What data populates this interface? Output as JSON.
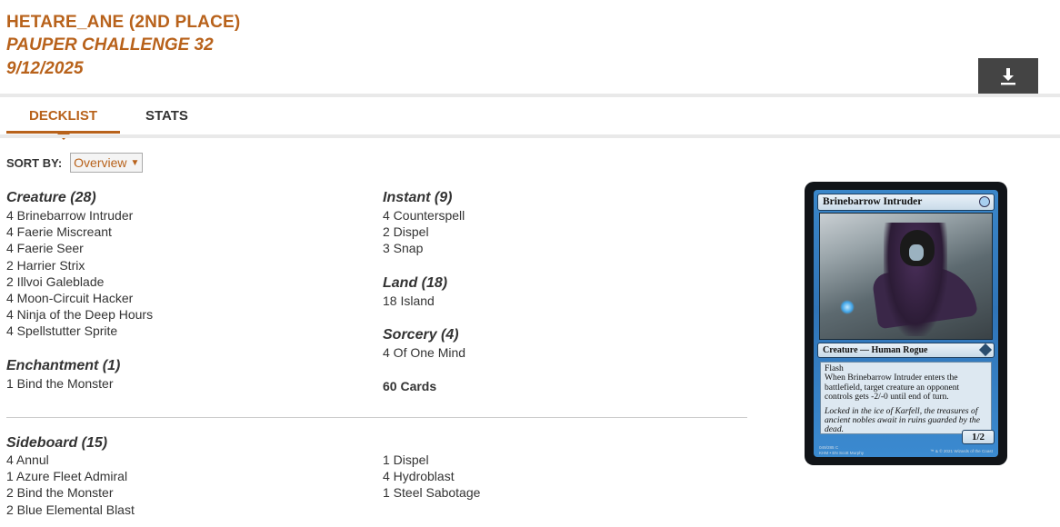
{
  "header": {
    "player": "HETARE_ANE (2ND PLACE)",
    "event": "PAUPER CHALLENGE 32",
    "date": "9/12/2025"
  },
  "tabs": [
    {
      "label": "DECKLIST",
      "active": true
    },
    {
      "label": "STATS",
      "active": false
    }
  ],
  "sort": {
    "label": "SORT BY:",
    "selected": "Overview"
  },
  "maindeck": {
    "creature": {
      "title": "Creature (28)",
      "cards": [
        "4 Brinebarrow Intruder",
        "4 Faerie Miscreant",
        "4 Faerie Seer",
        "2 Harrier Strix",
        "2 Illvoi Galeblade",
        "4 Moon-Circuit Hacker",
        "4 Ninja of the Deep Hours",
        "4 Spellstutter Sprite"
      ]
    },
    "enchantment": {
      "title": "Enchantment (1)",
      "cards": [
        "1 Bind the Monster"
      ]
    },
    "instant": {
      "title": "Instant (9)",
      "cards": [
        "4 Counterspell",
        "2 Dispel",
        "3 Snap"
      ]
    },
    "land": {
      "title": "Land (18)",
      "cards": [
        "18 Island"
      ]
    },
    "sorcery": {
      "title": "Sorcery (4)",
      "cards": [
        "4 Of One Mind"
      ]
    },
    "total": "60 Cards"
  },
  "sideboard": {
    "title": "Sideboard (15)",
    "col1": [
      "4 Annul",
      "1 Azure Fleet Admiral",
      "2 Bind the Monster",
      "2 Blue Elemental Blast"
    ],
    "col2": [
      "1 Dispel",
      "4 Hydroblast",
      "1 Steel Sabotage"
    ]
  },
  "card_preview": {
    "name": "Brinebarrow Intruder",
    "type_line": "Creature — Human Rogue",
    "rules_1": "Flash",
    "rules_2": "When Brinebarrow Intruder enters the battlefield, target creature an opponent controls gets -2/-0 until end of turn.",
    "flavor": "Locked in the ice of Karfell, the treasures of ancient nobles await in ruins guarded by the dead.",
    "pt": "1/2",
    "collector": "049/285 C",
    "set_line": "KHM • EN",
    "artist": "Scott Murphy",
    "copyright": "™ & © 2021 Wizards of the Coast"
  },
  "colors": {
    "accent": "#b8621b",
    "button_bg": "#444444"
  }
}
